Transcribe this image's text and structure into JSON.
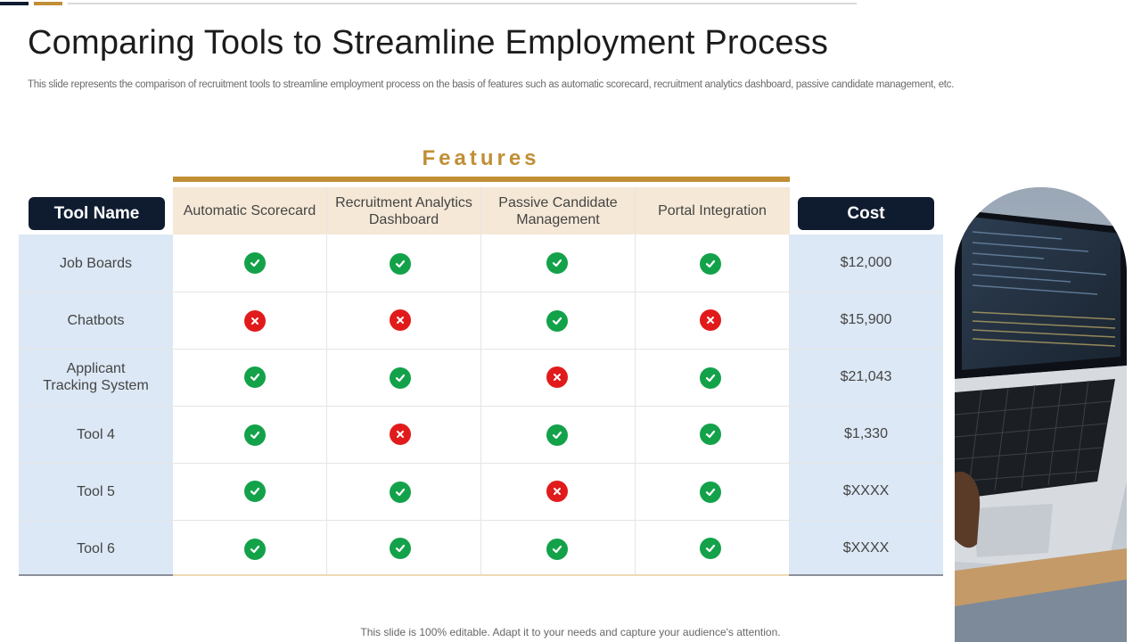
{
  "title": "Comparing Tools to Streamline Employment Process",
  "subtitle": "This slide represents the comparison of recruitment tools to streamline employment process on the basis of features such as automatic scorecard, recruitment analytics dashboard, passive candidate management, etc.",
  "features_label": "Features",
  "tool_name_header": "Tool Name",
  "cost_header": "Cost",
  "feature_columns": [
    "Automatic Scorecard",
    "Recruitment Analytics Dashboard",
    "Passive Candidate Management",
    "Portal Integration"
  ],
  "rows": [
    {
      "name": "Job Boards",
      "features": [
        true,
        true,
        true,
        true
      ],
      "cost": "$12,000"
    },
    {
      "name": "Chatbots",
      "features": [
        false,
        false,
        true,
        false
      ],
      "cost": "$15,900"
    },
    {
      "name": "Applicant Tracking System",
      "features": [
        true,
        true,
        false,
        true
      ],
      "cost": "$21,043"
    },
    {
      "name": "Tool 4",
      "features": [
        true,
        false,
        true,
        true
      ],
      "cost": "$1,330"
    },
    {
      "name": "Tool 5",
      "features": [
        true,
        true,
        false,
        true
      ],
      "cost": "$XXXX"
    },
    {
      "name": "Tool 6",
      "features": [
        true,
        true,
        true,
        true
      ],
      "cost": "$XXXX"
    }
  ],
  "footer": "This slide is 100% editable. Adapt it to your needs and capture your audience's attention.",
  "colors": {
    "navy": "#0f1c30",
    "gold": "#c08f36",
    "check": "#13a24a",
    "cross": "#e11b1b",
    "light_blue": "#dce8f5",
    "beige": "#f5e8d6"
  },
  "icons": {
    "yes": "check-circle-icon",
    "no": "x-circle-icon"
  }
}
